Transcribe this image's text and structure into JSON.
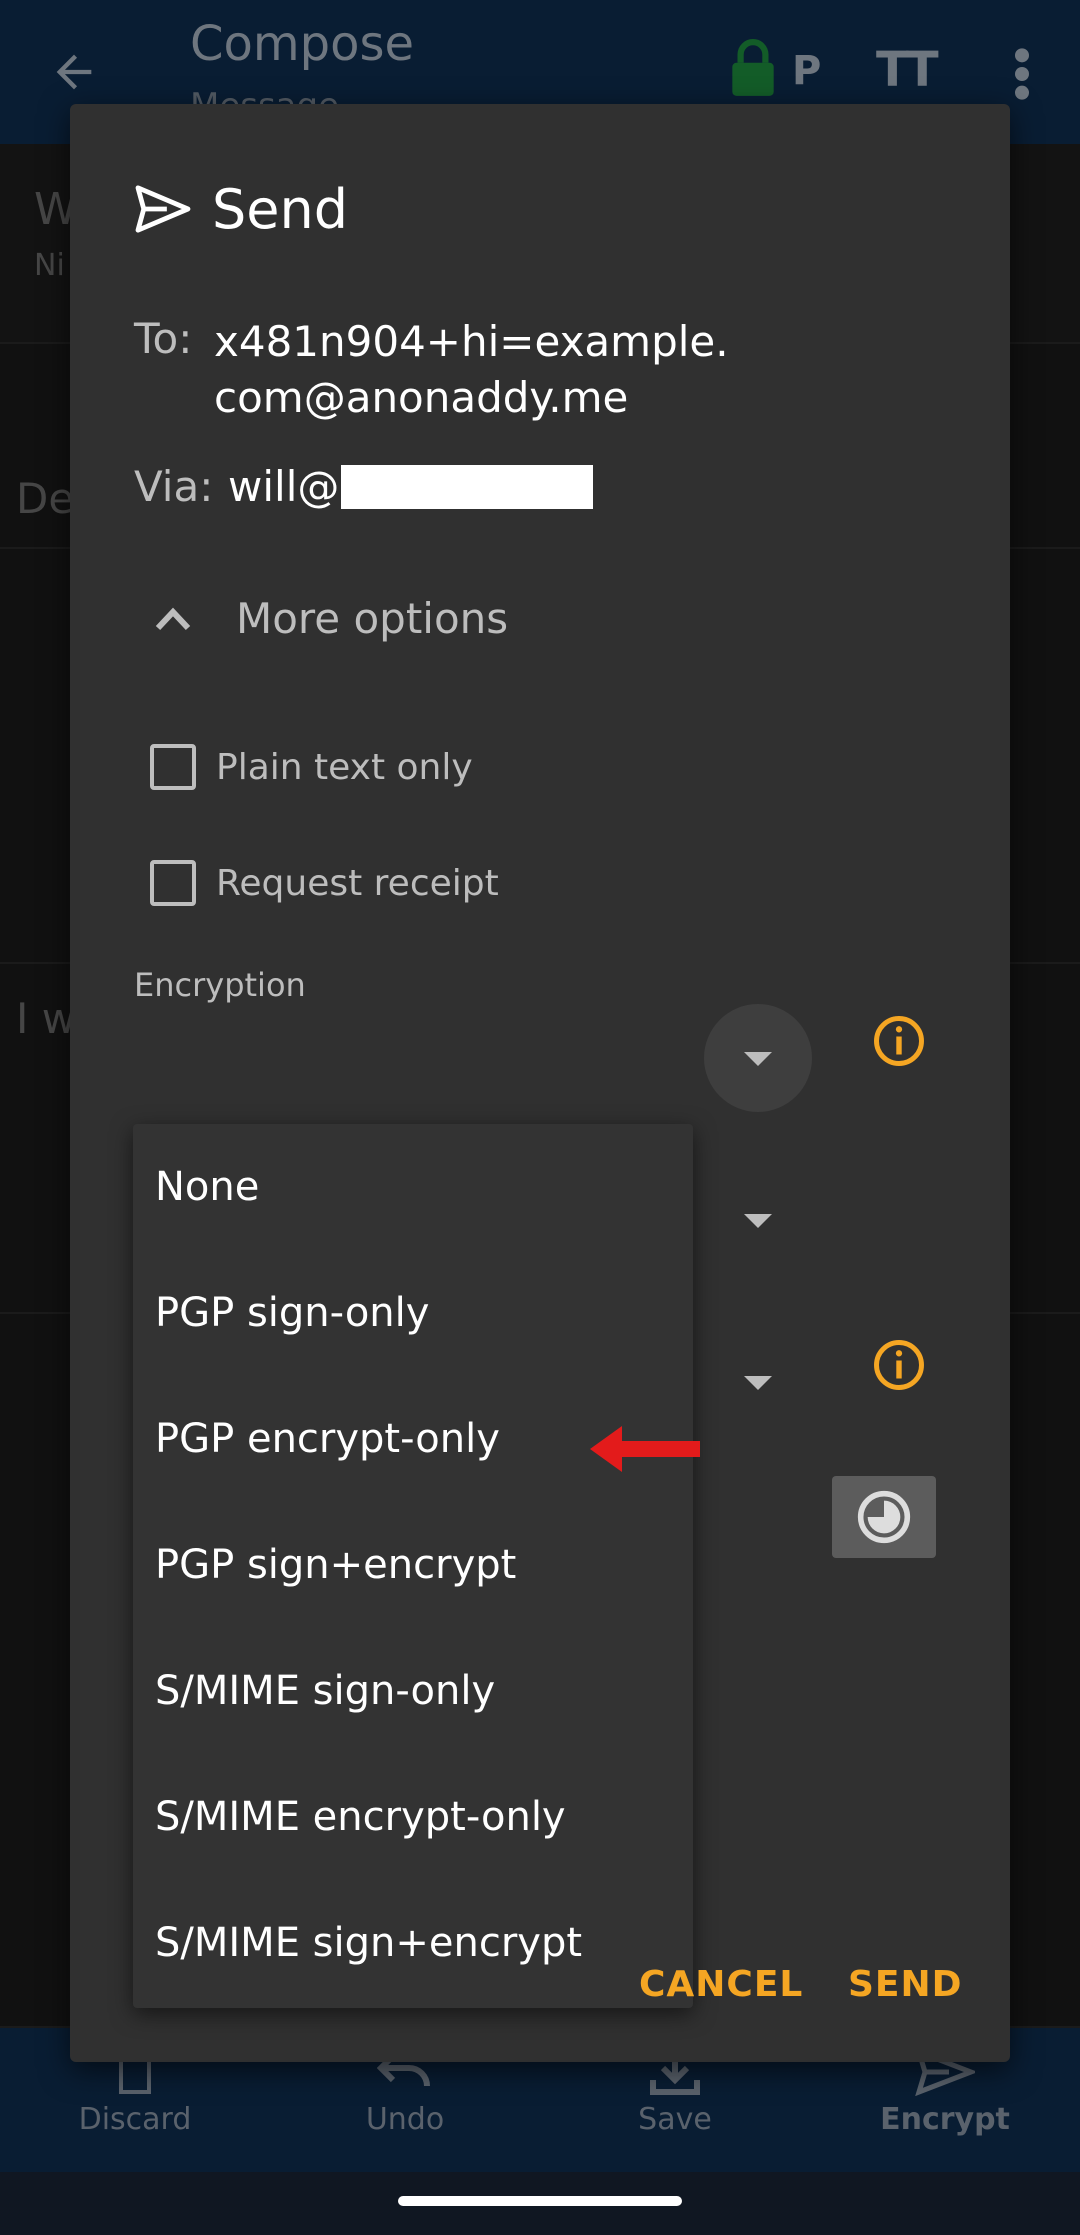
{
  "app": {
    "title": "Compose",
    "subtitle": "Message",
    "p_badge": "P",
    "text_size_glyph": "TT",
    "colors": {
      "appbar": "#0f2d4f",
      "accent": "#f5a623",
      "lock": "#1e8e3e"
    }
  },
  "background": {
    "row1_initial": "W",
    "row1_sub": "Ni",
    "row3_initial": "De",
    "row4_initial": "I w"
  },
  "dialog": {
    "title": "Send",
    "to_label": "To:",
    "to_value": "x481n904+hi=example.com@anonaddy.me",
    "via_label": "Via:",
    "via_value": "will@",
    "more_options": "More options",
    "plain_text_only": "Plain text only",
    "request_receipt": "Request receipt",
    "encryption_label": "Encryption",
    "cancel": "CANCEL",
    "send": "SEND"
  },
  "dropdown": {
    "options": [
      "None",
      "PGP sign-only",
      "PGP encrypt-only",
      "PGP sign+encrypt",
      "S/MIME sign-only",
      "S/MIME encrypt-only",
      "S/MIME sign+encrypt"
    ]
  },
  "bottom_nav": {
    "items": [
      "Discard",
      "Undo",
      "Save",
      "Encrypt"
    ]
  }
}
